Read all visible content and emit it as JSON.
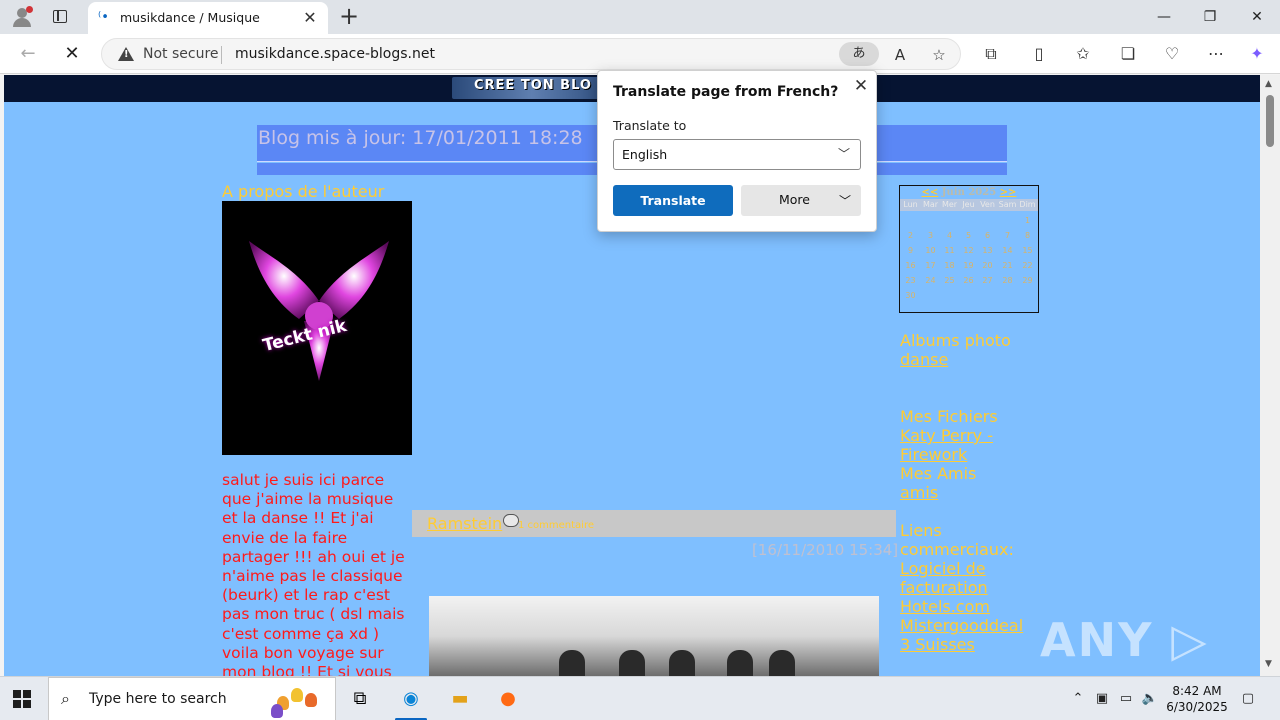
{
  "browser": {
    "tab_title": "musikdance / Musique",
    "tab_close": "✕",
    "new_tab": "+",
    "not_secure": "Not secure",
    "url": "musikdance.space-blogs.net",
    "translate_icon": "あ",
    "window_controls": [
      "—",
      "❐",
      "✕"
    ]
  },
  "page": {
    "banner_text": "CREE TON BLO",
    "header_text": "Blog mis à jour: 17/01/2011 18:28",
    "about_title": "A propos de l'auteur",
    "logo_text": "Teckt nik",
    "about_body": "salut je suis ici parce que j'aime la musique et la danse !! Et j'ai envie de la faire partager !!! ah oui et je n'aime pas le classique (beurk) et le rap c'est pas mon truc ( dsl mais c'est comme ça xd ) voila bon voyage sur mon blog !! Et si vous pouvez me conseillez ça serais super",
    "post": {
      "title": "Ramstein",
      "comment_link": "1 commentaire",
      "date": "[16/11/2010 15:34]"
    },
    "calendar": {
      "prev": "<<",
      "month": "Juin 2025",
      "next": ">>",
      "day_names": [
        "Lun",
        "Mar",
        "Mer",
        "Jeu",
        "Ven",
        "Sam",
        "Dim"
      ],
      "weeks": [
        [
          "",
          "",
          "",
          "",
          "",
          "",
          "1"
        ],
        [
          "2",
          "3",
          "4",
          "5",
          "6",
          "7",
          "8"
        ],
        [
          "9",
          "10",
          "11",
          "12",
          "13",
          "14",
          "15"
        ],
        [
          "16",
          "17",
          "18",
          "19",
          "20",
          "21",
          "22"
        ],
        [
          "23",
          "24",
          "25",
          "26",
          "27",
          "28",
          "29"
        ],
        [
          "30",
          "",
          "",
          "",
          "",
          "",
          ""
        ]
      ]
    },
    "sidebar": {
      "albums_title": "Albums photo",
      "albums_link": "danse",
      "files_title": "Mes Fichiers",
      "files_link_1": "Katy Perry -",
      "files_link_2": "Firework",
      "friends_title": "Mes Amis",
      "friends_link": "amis",
      "links_title_1": "Liens",
      "links_title_2": "commerciaux:",
      "link_1a": "Logiciel de",
      "link_1b": "facturation",
      "link_2": "Hotels.com",
      "link_3": "Mistergooddeal",
      "link_4": "3 Suisses"
    },
    "watermark": "ANY ▷ RUN"
  },
  "translate_popup": {
    "title": "Translate page from French?",
    "close": "✕",
    "label": "Translate to",
    "selected_language": "English",
    "translate_button": "Translate",
    "more_button": "More"
  },
  "taskbar": {
    "search_placeholder": "Type here to search",
    "time": "8:42 AM",
    "date": "6/30/2025"
  }
}
